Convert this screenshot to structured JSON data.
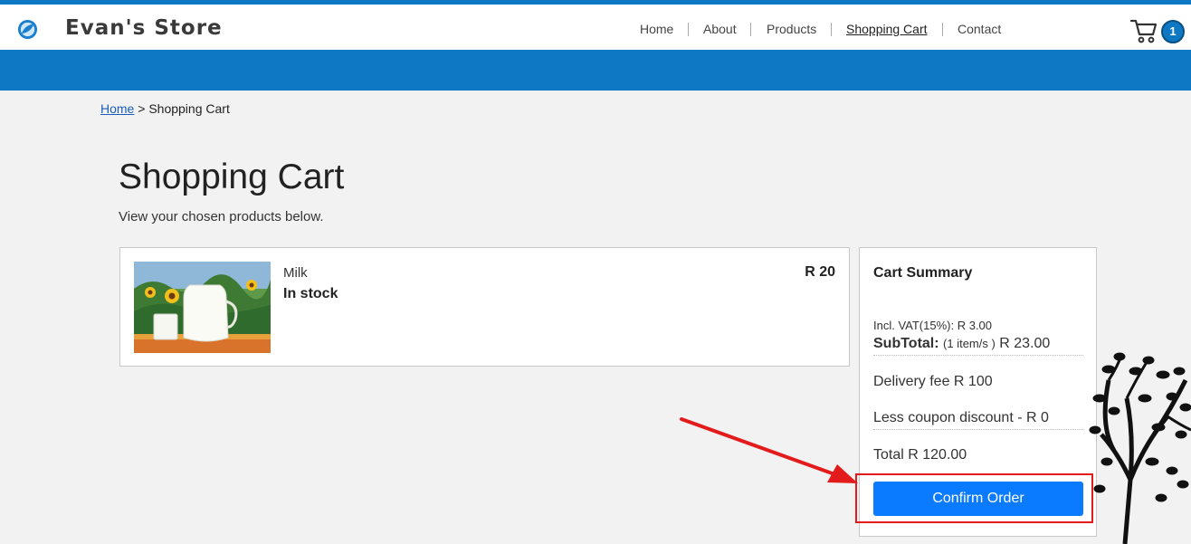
{
  "header": {
    "brand": "Evan's Store",
    "logo_icon": "leaf-logo-icon",
    "nav": [
      {
        "label": "Home",
        "active": false
      },
      {
        "label": "About",
        "active": false
      },
      {
        "label": "Products",
        "active": false
      },
      {
        "label": "Shopping Cart",
        "active": true
      },
      {
        "label": "Contact",
        "active": false
      }
    ],
    "cart_icon": "cart-icon",
    "cart_count": "1"
  },
  "breadcrumb": {
    "home": "Home",
    "separator": ">",
    "current": "Shopping Cart"
  },
  "page": {
    "title": "Shopping Cart",
    "subtitle": "View your chosen products below."
  },
  "cart_items": [
    {
      "name": "Milk",
      "stock": "In stock",
      "price": "R 20",
      "image": "milk-jug-sunflowers"
    }
  ],
  "summary": {
    "title": "Cart Summary",
    "vat": "Incl. VAT(15%): R 3.00",
    "subtotal_label": "SubTotal:",
    "subtotal_items": "(1 item/s )",
    "subtotal_value": "R 23.00",
    "delivery": "Delivery fee R 100",
    "coupon": "Less coupon discount - R 0",
    "total": "Total R 120.00",
    "confirm_label": "Confirm Order"
  },
  "colors": {
    "brand_blue": "#0e78c4",
    "button_blue": "#0a7bff",
    "annotation_red": "#e31b1b",
    "page_bg": "#f2f2f2"
  }
}
